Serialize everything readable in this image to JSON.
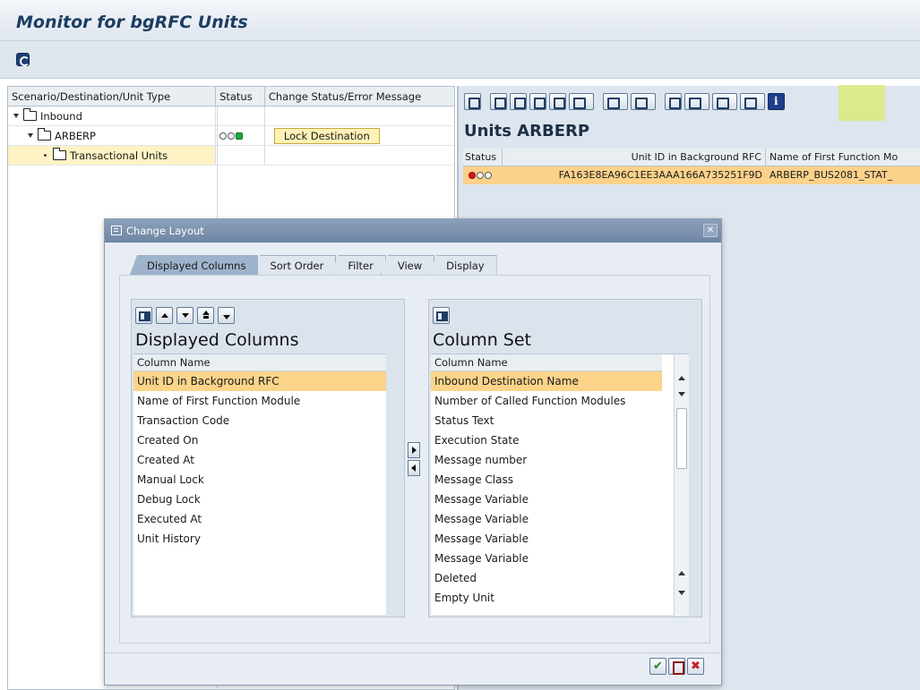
{
  "window": {
    "title": "Monitor for bgRFC Units"
  },
  "tree": {
    "headers": [
      "Scenario/Destination/Unit Type",
      "Status",
      "Change Status/Error Message"
    ],
    "rows": [
      {
        "label": "Inbound",
        "status": "",
        "action": ""
      },
      {
        "label": "ARBERP",
        "status": "",
        "action": "Lock Destination"
      },
      {
        "label": "Transactional Units",
        "status": "",
        "action": ""
      }
    ]
  },
  "units": {
    "title": "Units ARBERP",
    "headers": [
      "Status",
      "Unit ID in Background RFC",
      "Name of First Function Mo"
    ],
    "rows": [
      {
        "unit_id": "FA163E8EA96C1EE3AAA166A735251F9D",
        "function": "ARBERP_BUS2081_STAT_"
      }
    ]
  },
  "dialog": {
    "title": "Change Layout",
    "tabs": [
      "Displayed Columns",
      "Sort Order",
      "Filter",
      "View",
      "Display"
    ],
    "displayed": {
      "title": "Displayed Columns",
      "header": "Column Name",
      "items": [
        "Unit ID in Background RFC",
        "Name of First Function Module",
        "Transaction Code",
        "Created On",
        "Created At",
        "Manual Lock",
        "Debug Lock",
        "Executed At",
        "Unit History"
      ]
    },
    "column_set": {
      "title": "Column Set",
      "header": "Column Name",
      "items": [
        "Inbound Destination Name",
        "Number of Called Function Modules",
        "Status Text",
        "Execution State",
        "Message number",
        "Message Class",
        "Message Variable",
        "Message Variable",
        "Message Variable",
        "Message Variable",
        "Deleted",
        "Empty Unit"
      ]
    },
    "buttons": {
      "ok": "✔",
      "cancel": "✖"
    }
  },
  "colors": {
    "selection": "#fbd48a",
    "highlight": "#dbeb7a",
    "title_blue": "#1d3d62"
  }
}
